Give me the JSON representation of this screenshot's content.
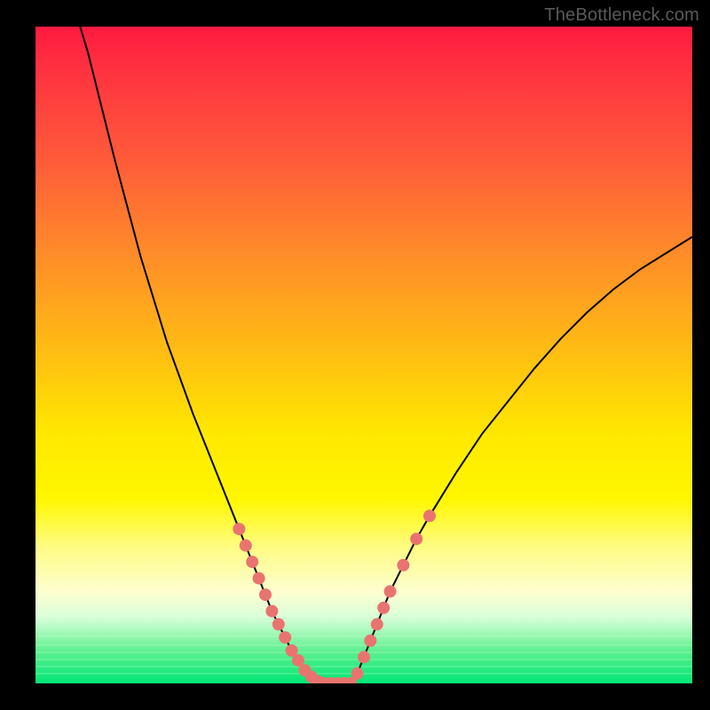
{
  "watermark": "TheBottleneck.com",
  "chart_data": {
    "type": "line",
    "title": "",
    "xlabel": "",
    "ylabel": "",
    "xlim": [
      0,
      100
    ],
    "ylim": [
      0,
      100
    ],
    "grid": false,
    "legend": false,
    "note": "Axes are unlabeled; x and y are estimated from pixel positions as percentages of the plot width/height. y = 0 at the bottom (green) edge, y = 100 at the top (red) edge.",
    "series": [
      {
        "name": "left-branch",
        "x": [
          6.8,
          8,
          12,
          16,
          20,
          24,
          26,
          28,
          30,
          31,
          32,
          33,
          34,
          35,
          36,
          37,
          38,
          39,
          40,
          41,
          42,
          43,
          44
        ],
        "y": [
          100,
          96,
          80,
          65,
          52,
          41,
          36,
          31,
          26,
          23.5,
          21,
          18.5,
          16,
          13.5,
          11,
          9,
          7,
          5,
          3.5,
          2,
          1,
          0.3,
          0
        ]
      },
      {
        "name": "valley-floor",
        "x": [
          44,
          45,
          46,
          47,
          48
        ],
        "y": [
          0,
          0,
          0,
          0,
          0
        ]
      },
      {
        "name": "right-branch",
        "x": [
          48,
          49,
          50,
          51,
          52,
          53,
          54,
          56,
          58,
          60,
          64,
          68,
          72,
          76,
          80,
          84,
          88,
          92,
          96,
          100
        ],
        "y": [
          0,
          1.5,
          4,
          6.5,
          9,
          11.5,
          14,
          18,
          22,
          25.5,
          32,
          38,
          43,
          48,
          52.5,
          56.5,
          60,
          63,
          65.5,
          68
        ]
      }
    ],
    "scatter": {
      "name": "highlighted-points",
      "color": "#e9746f",
      "points": [
        [
          31,
          23.5
        ],
        [
          32,
          21
        ],
        [
          33,
          18.5
        ],
        [
          34,
          16
        ],
        [
          35,
          13.5
        ],
        [
          36,
          11
        ],
        [
          37,
          9
        ],
        [
          38,
          7
        ],
        [
          39,
          5
        ],
        [
          40,
          3.5
        ],
        [
          41,
          2
        ],
        [
          42,
          1
        ],
        [
          43,
          0.3
        ],
        [
          44,
          0
        ],
        [
          45,
          0
        ],
        [
          46,
          0
        ],
        [
          47,
          0
        ],
        [
          48,
          0
        ],
        [
          49,
          1.5
        ],
        [
          50,
          4
        ],
        [
          51,
          6.5
        ],
        [
          52,
          9
        ],
        [
          53,
          11.5
        ],
        [
          54,
          14
        ],
        [
          56,
          18
        ],
        [
          58,
          22
        ],
        [
          60,
          25.5
        ]
      ]
    },
    "background_gradient": {
      "top": "#ff1a40",
      "upper_mid": "#ff8a2a",
      "mid": "#ffe800",
      "lower_mid": "#fdfed0",
      "bottom": "#00e676"
    }
  }
}
